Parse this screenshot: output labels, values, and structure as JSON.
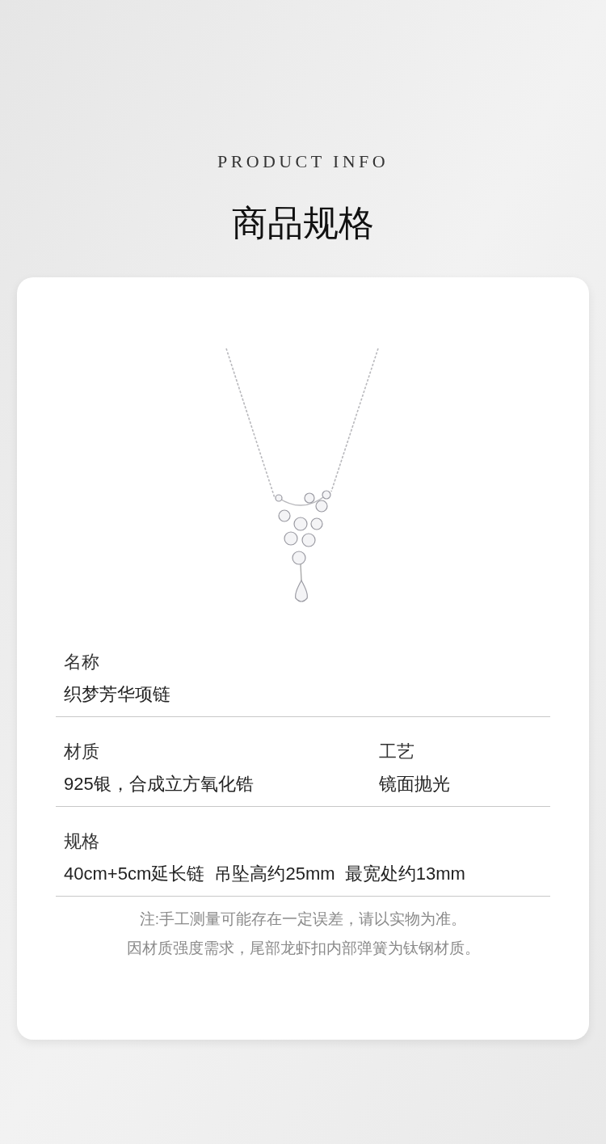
{
  "header": {
    "subtitle": "PRODUCT INFO",
    "title": "商品规格"
  },
  "specs": [
    {
      "fields": [
        {
          "label": "名称",
          "value": "织梦芳华项链"
        }
      ]
    },
    {
      "fields": [
        {
          "label": "材质",
          "value": "925银，合成立方氧化锆"
        },
        {
          "label": "工艺",
          "value": "镜面抛光"
        }
      ]
    },
    {
      "fields": [
        {
          "label": "规格",
          "value": "40cm+5cm延长链  吊坠高约25mm  最宽处约13mm"
        }
      ]
    }
  ],
  "notes": [
    "注:手工测量可能存在一定误差，请以实物为准。",
    "因材质强度需求，尾部龙虾扣内部弹簧为钛钢材质。"
  ]
}
